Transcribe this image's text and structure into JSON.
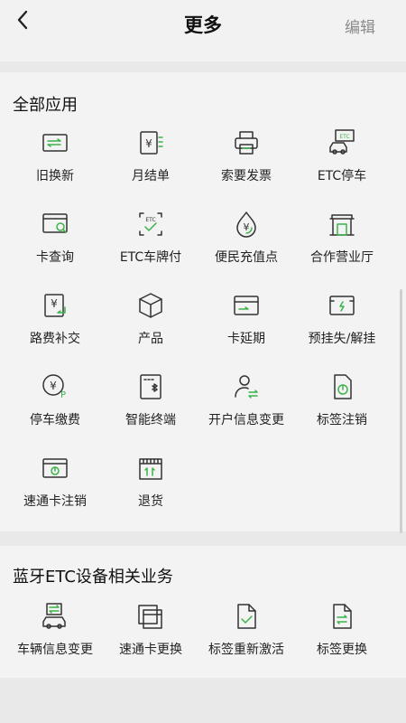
{
  "header": {
    "title": "更多",
    "edit_label": "编辑"
  },
  "colors": {
    "accent": "#3cb34a",
    "icon": "#333333"
  },
  "sections": [
    {
      "title": "全部应用",
      "items": [
        {
          "label": "旧换新",
          "icon": "card-exchange-icon"
        },
        {
          "label": "月结单",
          "icon": "monthly-bill-icon"
        },
        {
          "label": "索要发票",
          "icon": "printer-icon"
        },
        {
          "label": "ETC停车",
          "icon": "etc-parking-icon"
        },
        {
          "label": "卡查询",
          "icon": "card-search-icon"
        },
        {
          "label": "ETC车牌付",
          "icon": "etc-plate-pay-icon"
        },
        {
          "label": "便民充值点",
          "icon": "recharge-point-icon"
        },
        {
          "label": "合作营业厅",
          "icon": "service-hall-icon"
        },
        {
          "label": "路费补交",
          "icon": "toll-repay-icon"
        },
        {
          "label": "产品",
          "icon": "product-box-icon"
        },
        {
          "label": "卡延期",
          "icon": "card-extend-icon"
        },
        {
          "label": "预挂失/解挂",
          "icon": "card-lock-icon"
        },
        {
          "label": "停车缴费",
          "icon": "parking-fee-icon"
        },
        {
          "label": "智能终端",
          "icon": "bluetooth-terminal-icon"
        },
        {
          "label": "开户信息变更",
          "icon": "user-change-icon"
        },
        {
          "label": "标签注销",
          "icon": "tag-cancel-icon"
        },
        {
          "label": "速通卡注销",
          "icon": "card-cancel-icon"
        },
        {
          "label": "退货",
          "icon": "return-box-icon"
        }
      ]
    },
    {
      "title": "蓝牙ETC设备相关业务",
      "items": [
        {
          "label": "车辆信息变更",
          "icon": "vehicle-change-icon"
        },
        {
          "label": "速通卡更换",
          "icon": "card-replace-icon"
        },
        {
          "label": "标签重新激活",
          "icon": "tag-reactivate-icon"
        },
        {
          "label": "标签更换",
          "icon": "tag-replace-icon"
        }
      ]
    }
  ]
}
